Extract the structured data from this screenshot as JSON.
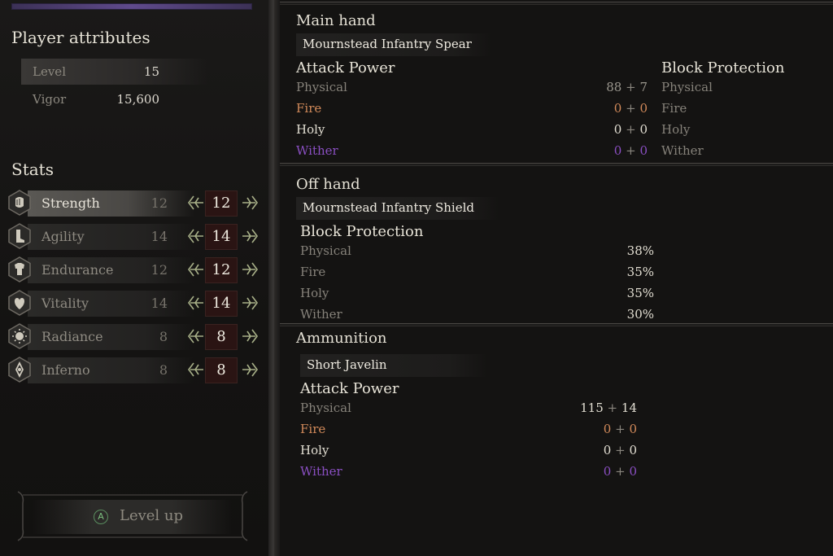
{
  "left": {
    "attributes_title": "Player attributes",
    "attributes": [
      {
        "label": "Level",
        "value": "15"
      },
      {
        "label": "Vigor",
        "value": "15,600"
      }
    ],
    "stats_title": "Stats",
    "stats": [
      {
        "label": "Strength",
        "base": "12",
        "value": "12",
        "icon": "fist-icon"
      },
      {
        "label": "Agility",
        "base": "14",
        "value": "14",
        "icon": "boot-icon"
      },
      {
        "label": "Endurance",
        "base": "12",
        "value": "12",
        "icon": "armor-icon"
      },
      {
        "label": "Vitality",
        "base": "14",
        "value": "14",
        "icon": "heart-icon"
      },
      {
        "label": "Radiance",
        "base": "8",
        "value": "8",
        "icon": "sun-icon"
      },
      {
        "label": "Inferno",
        "base": "8",
        "value": "8",
        "icon": "flame-icon"
      }
    ],
    "level_up": {
      "key": "A",
      "label": "Level up"
    }
  },
  "main_hand": {
    "title": "Main hand",
    "item": "Mournstead Infantry Spear",
    "attack_title": "Attack Power",
    "block_title": "Block Protection",
    "attack": [
      {
        "label": "Physical",
        "base": "88",
        "bonus": "7"
      },
      {
        "label": "Fire",
        "base": "0",
        "bonus": "0"
      },
      {
        "label": "Holy",
        "base": "0",
        "bonus": "0"
      },
      {
        "label": "Wither",
        "base": "0",
        "bonus": "0"
      }
    ],
    "block": [
      "Physical",
      "Fire",
      "Holy",
      "Wither"
    ],
    "plus": "+"
  },
  "off_hand": {
    "title": "Off hand",
    "item": "Mournstead Infantry Shield",
    "block_title": "Block Protection",
    "block": [
      {
        "label": "Physical",
        "value": "38%"
      },
      {
        "label": "Fire",
        "value": "35%"
      },
      {
        "label": "Holy",
        "value": "35%"
      },
      {
        "label": "Wither",
        "value": "30%"
      }
    ]
  },
  "ammunition": {
    "title": "Ammunition",
    "item": "Short Javelin",
    "attack_title": "Attack Power",
    "attack": [
      {
        "label": "Physical",
        "base": "115",
        "bonus": "14"
      },
      {
        "label": "Fire",
        "base": "0",
        "bonus": "0"
      },
      {
        "label": "Holy",
        "base": "0",
        "bonus": "0"
      },
      {
        "label": "Wither",
        "base": "0",
        "bonus": "0"
      }
    ]
  },
  "colors": {
    "fire": "#d28a5a",
    "holy": "#e2ded2",
    "wither": "#8a4fc2",
    "accent_bar": "#5f4a8c",
    "stat_box": "#2a1413"
  }
}
